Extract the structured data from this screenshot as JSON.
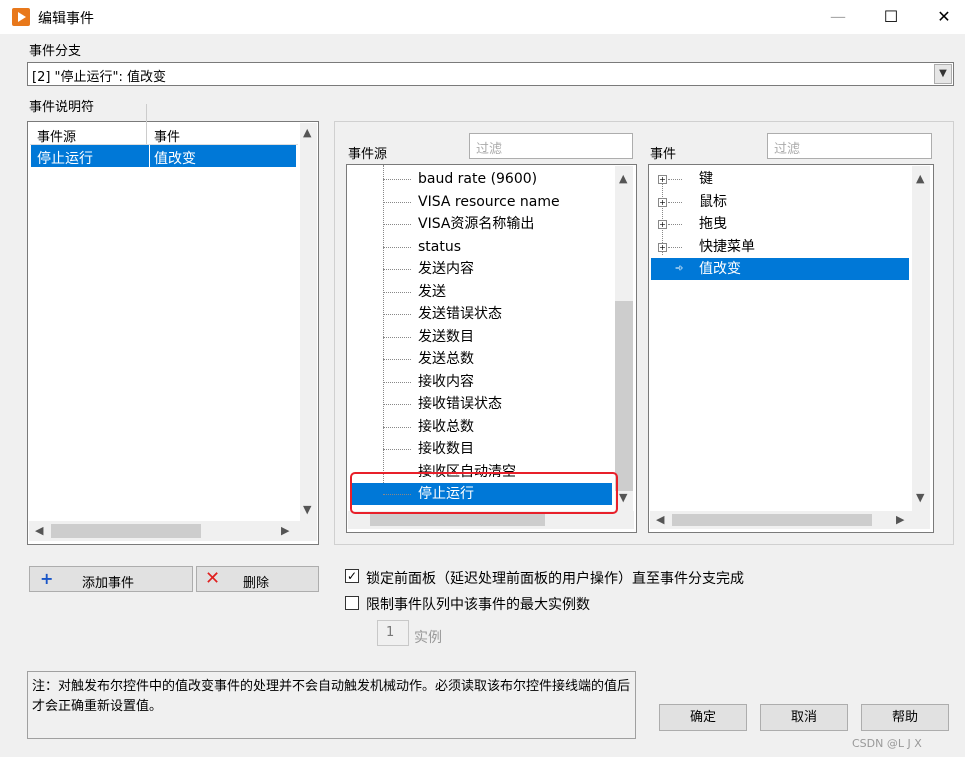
{
  "window": {
    "title": "编辑事件",
    "min": "—",
    "max": "☐",
    "close": "✕"
  },
  "branch": {
    "label": "事件分支",
    "value": "[2] \"停止运行\": 值改变"
  },
  "specifiers": {
    "label": "事件说明符",
    "col_source": "事件源",
    "col_event": "事件",
    "rows": [
      {
        "source": "停止运行",
        "event": "值改变"
      }
    ]
  },
  "source_panel": {
    "label": "事件源",
    "filter_placeholder": "过滤",
    "items": [
      "baud rate (9600)",
      "VISA resource name",
      "VISA资源名称输出",
      "status",
      "发送内容",
      "发送",
      "发送错误状态",
      "发送数目",
      "发送总数",
      "接收内容",
      " 接收错误状态",
      "接收总数",
      "接收数目",
      "接收区自动清空",
      "停止运行"
    ],
    "selected_index": 14
  },
  "event_panel": {
    "label": "事件",
    "filter_placeholder": "过滤",
    "items": [
      {
        "label": "键",
        "expandable": true
      },
      {
        "label": "鼠标",
        "expandable": true
      },
      {
        "label": "拖曳",
        "expandable": true
      },
      {
        "label": "快捷菜单",
        "expandable": true
      },
      {
        "label": "值改变",
        "expandable": false
      }
    ],
    "selected_index": 4
  },
  "buttons": {
    "add": "添加事件",
    "delete": "删除",
    "ok": "确定",
    "cancel": "取消",
    "help": "帮助"
  },
  "options": {
    "lock_front_panel": "锁定前面板（延迟处理前面板的用户操作）直至事件分支完成",
    "lock_checked": true,
    "limit_instances": "限制事件队列中该事件的最大实例数",
    "limit_checked": false,
    "instances_value": "1",
    "instances_label": "实例"
  },
  "note": "注：对触发布尔控件中的值改变事件的处理并不会自动触发机械动作。必须读取该布尔控件接线端的值后才会正确重新设置值。",
  "watermark": "CSDN @L J X",
  "colors": {
    "selection": "#0078d7",
    "highlight_box": "#e8202a",
    "app_icon": "#e8781b"
  }
}
